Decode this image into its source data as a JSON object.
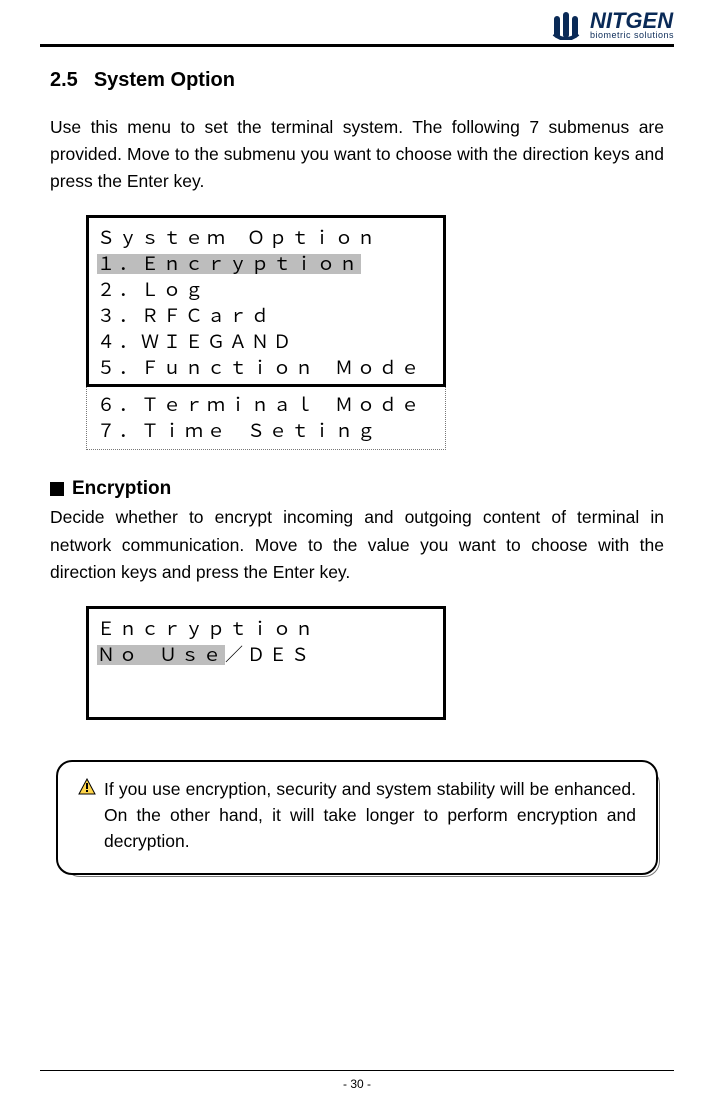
{
  "brand": {
    "name": "NITGEN",
    "tagline": "biometric solutions"
  },
  "section": {
    "number": "2.5",
    "title": "System Option",
    "intro": "Use this menu to set the terminal system. The following 7 submenus are provided. Move to the submenu you want to choose with the direction keys and press the Enter key."
  },
  "menu1": {
    "title": "Ｓｙｓｔｅｍ  Ｏｐｔｉｏｎ",
    "item1": "１．Ｅｎｃｒｙｐｔｉｏｎ",
    "item2": "２．Ｌｏｇ",
    "item3": "３．ＲＦＣａｒｄ",
    "item4": "４．ＷＩＥＧＡＮＤ",
    "item5": "５．Ｆｕｎｃｔｉｏｎ  Ｍｏｄｅ",
    "item6": "６．Ｔｅｒｍｉｎａｌ  Ｍｏｄｅ",
    "item7": "７．Ｔｉｍｅ  Ｓｅｔｉｎｇ"
  },
  "encryption": {
    "heading": "Encryption",
    "desc": "Decide whether to encrypt incoming and outgoing content of terminal in network communication. Move to the value you want to choose with the direction keys and press the Enter key.",
    "lcd_title": "Ｅｎｃｒｙｐｔｉｏｎ",
    "opt_sel": "Ｎｏ  Ｕｓｅ",
    "opt_rest": "／ＤＥＳ"
  },
  "notice": {
    "text": "If you use encryption, security and system stability will be enhanced. On the other hand, it will take longer to perform encryption and decryption."
  },
  "footer": {
    "page": "- 30 -"
  }
}
